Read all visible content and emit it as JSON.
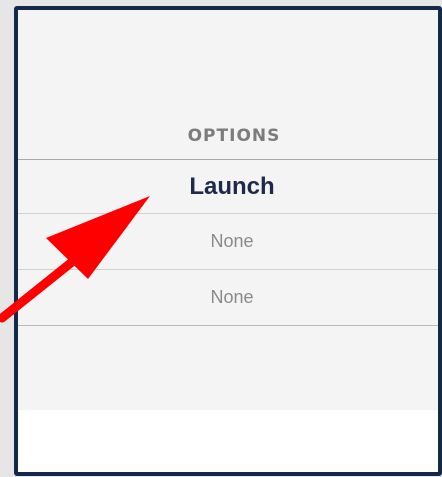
{
  "table": {
    "column_header": "OPTIONS",
    "rows": [
      {
        "label": "Launch",
        "state": "highlighted"
      },
      {
        "label": "None"
      },
      {
        "label": "None"
      }
    ]
  },
  "annotation": {
    "icon": "arrow-icon",
    "color": "#ff0000",
    "points_to": "Launch"
  },
  "colors": {
    "frame": "#14294a",
    "header_text": "#7c7c7c",
    "active_text": "#1e2a4a",
    "muted_text": "#8a8a8a"
  }
}
